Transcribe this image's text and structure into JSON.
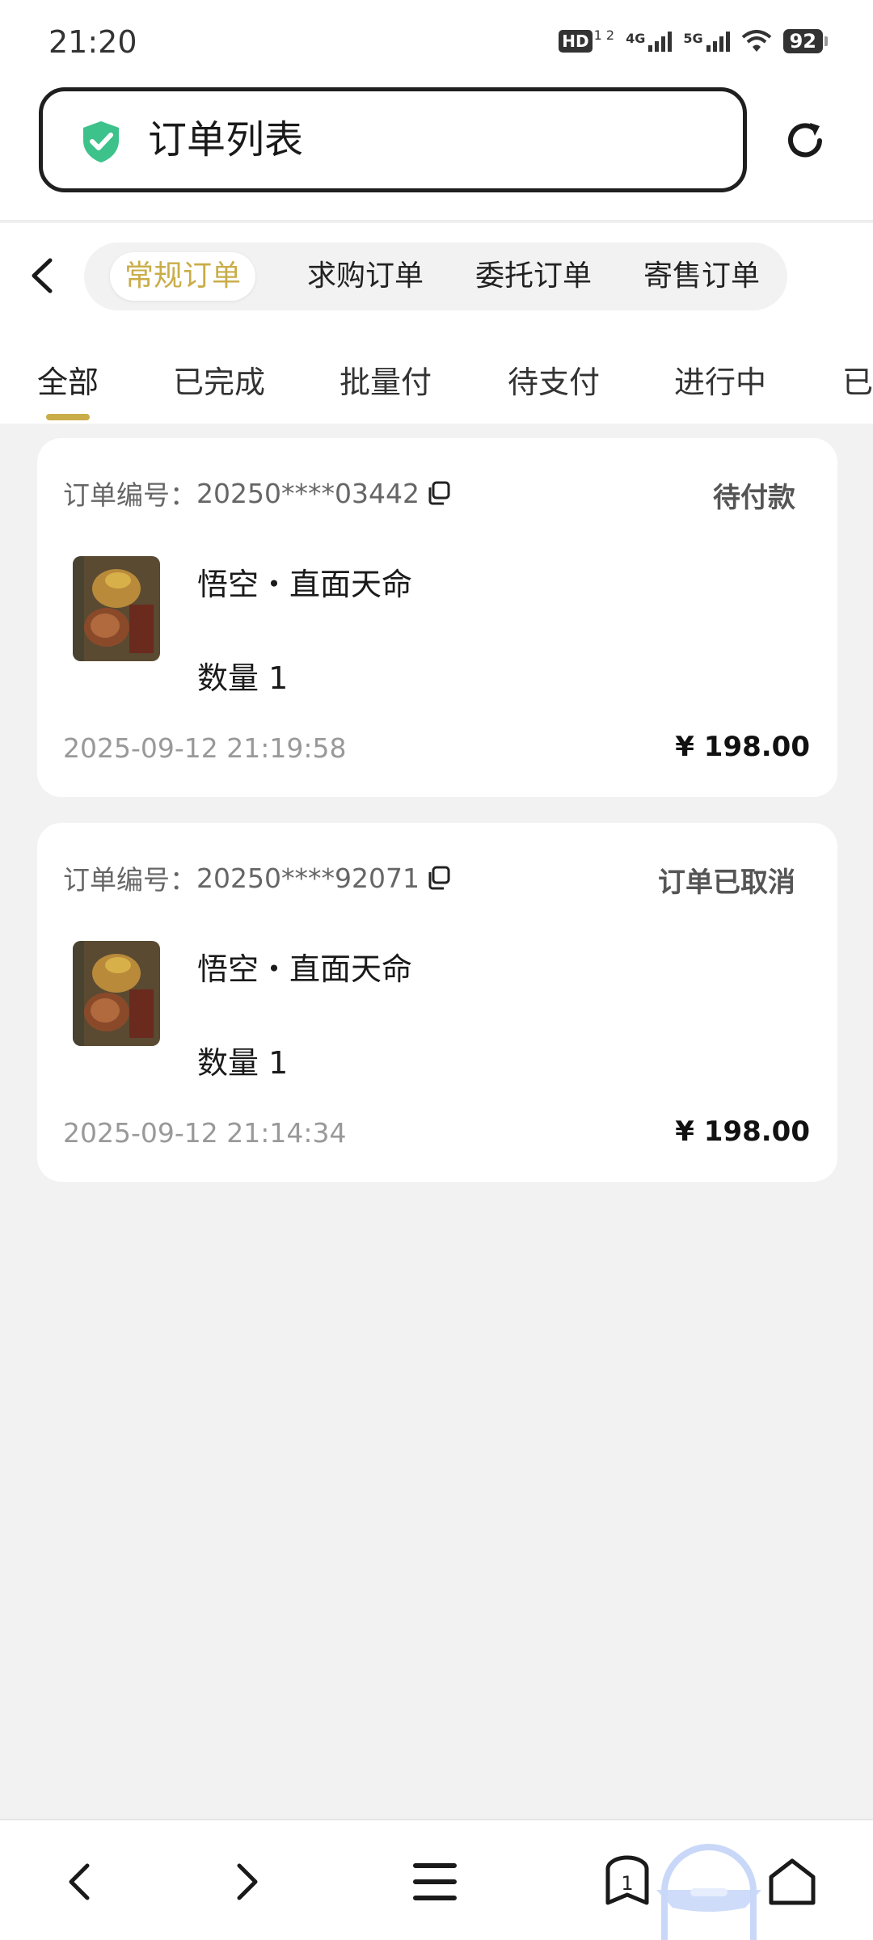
{
  "status_bar": {
    "time": "21:20",
    "hd_label": "HD",
    "hd_sub": "1 2",
    "net1": "4G",
    "net2": "5G",
    "battery": "92"
  },
  "address_bar": {
    "title": "订单列表",
    "icons": [
      "shield-check-icon",
      "refresh-icon"
    ],
    "accent": "#3cc28a"
  },
  "category_tabs": {
    "items": [
      "常规订单",
      "求购订单",
      "委托订单",
      "寄售订单"
    ],
    "active_index": 0,
    "active_color": "#c9ad49"
  },
  "status_tabs": {
    "items": [
      "全部",
      "已完成",
      "批量付",
      "待支付",
      "进行中",
      "已"
    ],
    "active_index": 0
  },
  "orders": [
    {
      "order_label": "订单编号：",
      "order_no": "20250****03442",
      "status": "待付款",
      "product": "悟空・直面天命",
      "quantity": "数量 1",
      "date": "2025-09-12 21:19:58",
      "price": "¥ 198.00"
    },
    {
      "order_label": "订单编号：",
      "order_no": "20250****92071",
      "status": "订单已取消",
      "product": "悟空・直面天命",
      "quantity": "数量 1",
      "date": "2025-09-12 21:14:34",
      "price": "¥ 198.00"
    }
  ],
  "bottom_nav": {
    "tab_count": "1",
    "icons": [
      "back-arrow-icon",
      "forward-arrow-icon",
      "menu-icon",
      "tabs-icon",
      "home-icon"
    ]
  }
}
